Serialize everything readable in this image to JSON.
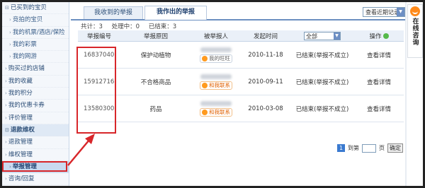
{
  "sidebar": {
    "items": [
      {
        "label": "已买到的宝贝",
        "kind": "group"
      },
      {
        "label": "竞拍的宝贝",
        "kind": "item"
      },
      {
        "label": "我的机票/酒店/保险",
        "kind": "item"
      },
      {
        "label": "我的彩票",
        "kind": "item"
      },
      {
        "label": "我的网游",
        "kind": "item"
      },
      {
        "label": "购买过的店铺",
        "kind": "group"
      },
      {
        "label": "我的收藏",
        "kind": "group"
      },
      {
        "label": "我的积分",
        "kind": "group"
      },
      {
        "label": "我的优惠卡券",
        "kind": "group"
      },
      {
        "label": "评价管理",
        "kind": "group"
      },
      {
        "label": "退款维权",
        "kind": "section"
      },
      {
        "label": "退款管理",
        "kind": "group"
      },
      {
        "label": "维权管理",
        "kind": "group"
      },
      {
        "label": "举报管理",
        "kind": "active"
      },
      {
        "label": "咨询/回复",
        "kind": "group"
      }
    ]
  },
  "tabs": [
    {
      "label": "我收到的举报"
    },
    {
      "label": "我作出的举报"
    }
  ],
  "filter": {
    "value": "查看近期记录"
  },
  "summary": {
    "total": "共计：3",
    "processing": "处理中：0",
    "done": "已结束：3"
  },
  "table": {
    "headers": {
      "id": "举报编号",
      "reason": "举报原因",
      "reported": "被举报人",
      "time": "发起时间",
      "status_select": "全部",
      "action": "操作"
    },
    "rows": [
      {
        "id": "16837040",
        "reason": "保护动植物",
        "badge": "我的旺旺",
        "time": "2010-11-18",
        "status": "已结束(举报不成立)",
        "action": "查看详情"
      },
      {
        "id": "15912716",
        "reason": "不合格商品",
        "badge": "和我联系",
        "time": "2010-09-11",
        "status": "已结束(举报不成立)",
        "action": "查看详情"
      },
      {
        "id": "13580300",
        "reason": "药品",
        "badge": "和我联系",
        "time": "2010-03-08",
        "status": "已结束(举报不成立)",
        "action": "查看详情"
      }
    ]
  },
  "pager": {
    "current": "1",
    "goto_label": "到第",
    "page_unit": "页",
    "confirm": "确定"
  },
  "consult": {
    "label": "在线咨询"
  }
}
